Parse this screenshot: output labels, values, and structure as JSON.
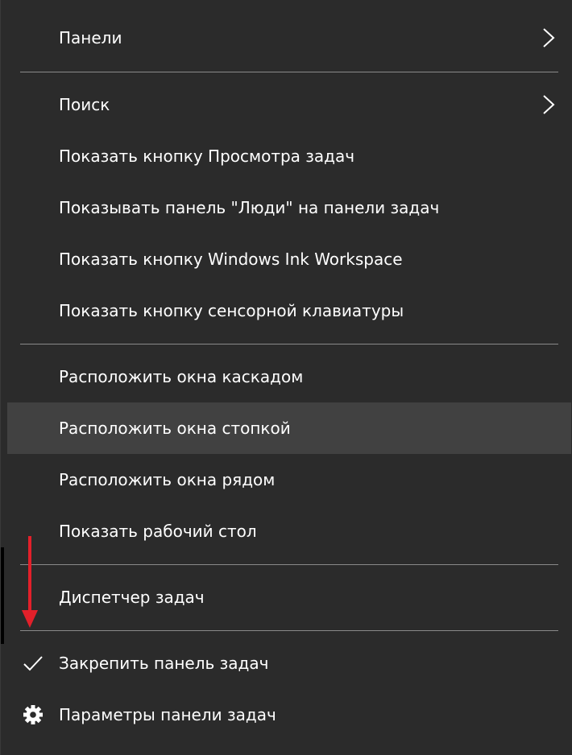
{
  "menu": {
    "items": [
      {
        "label": "Панели"
      },
      {
        "label": "Поиск"
      },
      {
        "label": "Показать кнопку Просмотра задач"
      },
      {
        "label": "Показывать панель \"Люди\" на панели задач"
      },
      {
        "label": "Показать кнопку Windows Ink Workspace"
      },
      {
        "label": "Показать кнопку сенсорной клавиатуры"
      },
      {
        "label": "Расположить окна каскадом"
      },
      {
        "label": "Расположить окна стопкой"
      },
      {
        "label": "Расположить окна рядом"
      },
      {
        "label": "Показать рабочий стол"
      },
      {
        "label": "Диспетчер задач"
      },
      {
        "label": "Закрепить панель задач"
      },
      {
        "label": "Параметры панели задач"
      }
    ],
    "icons": {
      "submenu": "chevron-right-icon",
      "checked": "checkmark-icon",
      "settings": "gear-icon",
      "annotation": "red-arrow-down-icon"
    }
  },
  "colors": {
    "background": "#2b2b2b",
    "highlight": "#414141",
    "separator": "#8a8a8a",
    "text": "#ffffff",
    "annotation_arrow": "#e2202a"
  }
}
